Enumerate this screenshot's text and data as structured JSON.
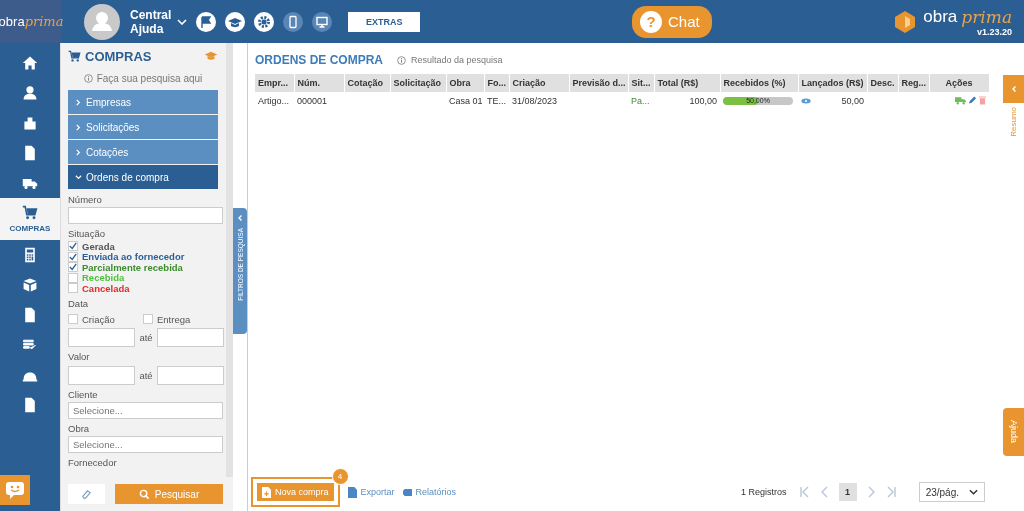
{
  "header": {
    "logo": {
      "word1": "obra",
      "word2": "prima"
    },
    "user": {
      "line1": "Central",
      "line2": "Ajuda"
    },
    "extras_button": "EXTRAS",
    "chat_icon": "?",
    "chat_button": "Chat",
    "brand": {
      "word1": "obra",
      "word2": "prima",
      "version": "v1.23.20"
    }
  },
  "nav": {
    "items": [
      {
        "kind": "home",
        "selected": false
      },
      {
        "kind": "user",
        "selected": false
      },
      {
        "kind": "building",
        "selected": false
      },
      {
        "kind": "invoice",
        "selected": false
      },
      {
        "kind": "truck",
        "selected": false
      },
      {
        "kind": "cart",
        "label": "COMPRAS",
        "selected": true
      },
      {
        "kind": "calculator",
        "selected": false
      },
      {
        "kind": "boxes",
        "selected": false
      },
      {
        "kind": "doc-check",
        "selected": false
      },
      {
        "kind": "list-check",
        "selected": false
      },
      {
        "kind": "helmet",
        "selected": false
      },
      {
        "kind": "document",
        "selected": false
      }
    ]
  },
  "filter_panel": {
    "title": "COMPRAS",
    "hint": "Faça sua pesquisa aqui",
    "sections": [
      {
        "label": "Empresas",
        "expanded": false
      },
      {
        "label": "Solicitações",
        "expanded": false
      },
      {
        "label": "Cotações",
        "expanded": false
      },
      {
        "label": "Ordens de compra",
        "expanded": true
      }
    ],
    "number_label": "Número",
    "status_label": "Situação",
    "statuses": [
      {
        "label": "Gerada",
        "checked": true,
        "color": "#555555"
      },
      {
        "label": "Enviada ao fornecedor",
        "checked": true,
        "color": "#2b5f94"
      },
      {
        "label": "Parcialmente recebida",
        "checked": true,
        "color": "#3d8b2f"
      },
      {
        "label": "Recebida",
        "checked": false,
        "color": "#4cc43a"
      },
      {
        "label": "Cancelada",
        "checked": false,
        "color": "#e02b2b"
      }
    ],
    "date_label": "Data",
    "date_options": [
      {
        "label": "Criação",
        "checked": false
      },
      {
        "label": "Entrega",
        "checked": false
      }
    ],
    "date_until": "até",
    "value_label": "Valor",
    "value_until": "até",
    "client": {
      "label": "Cliente",
      "placeholder": "Selecione..."
    },
    "work": {
      "label": "Obra",
      "placeholder": "Selecione..."
    },
    "supplier_label": "Fornecedor",
    "search_button": "Pesquisar"
  },
  "filter_tab": "FILTROS DE PESQUISA",
  "main": {
    "title": "ORDENS DE COMPRA",
    "hint": "Resultado da pesquisa",
    "table": {
      "columns": [
        "Empr...",
        "Núm.",
        "Cotação",
        "Solicitação",
        "Obra",
        "Fo...",
        "Criação",
        "Previsão d...",
        "Sit...",
        "Total (R$)",
        "Recebidos (%)",
        "Lançados (R$)",
        "Desc.",
        "Reg...",
        "Ações"
      ],
      "rows": [
        {
          "cells": [
            "Artigo...",
            "000001",
            "",
            "",
            "Casa 01",
            "TE...",
            "31/08/2023",
            "",
            "Pa...",
            "100,00"
          ],
          "received": {
            "level": 0.5,
            "label": "50,00%"
          },
          "posted": "50,00"
        }
      ]
    },
    "footer": {
      "actions": [
        {
          "kind": "new",
          "label": "Nova compra",
          "badge": "4"
        },
        {
          "kind": "export",
          "label": "Exportar"
        },
        {
          "kind": "reports",
          "label": "Relatórios"
        }
      ],
      "records": "1 Registros",
      "page": "1",
      "page_size": "23/pág."
    }
  },
  "right": {
    "summary": "Resumo",
    "help": "Ajuda"
  }
}
